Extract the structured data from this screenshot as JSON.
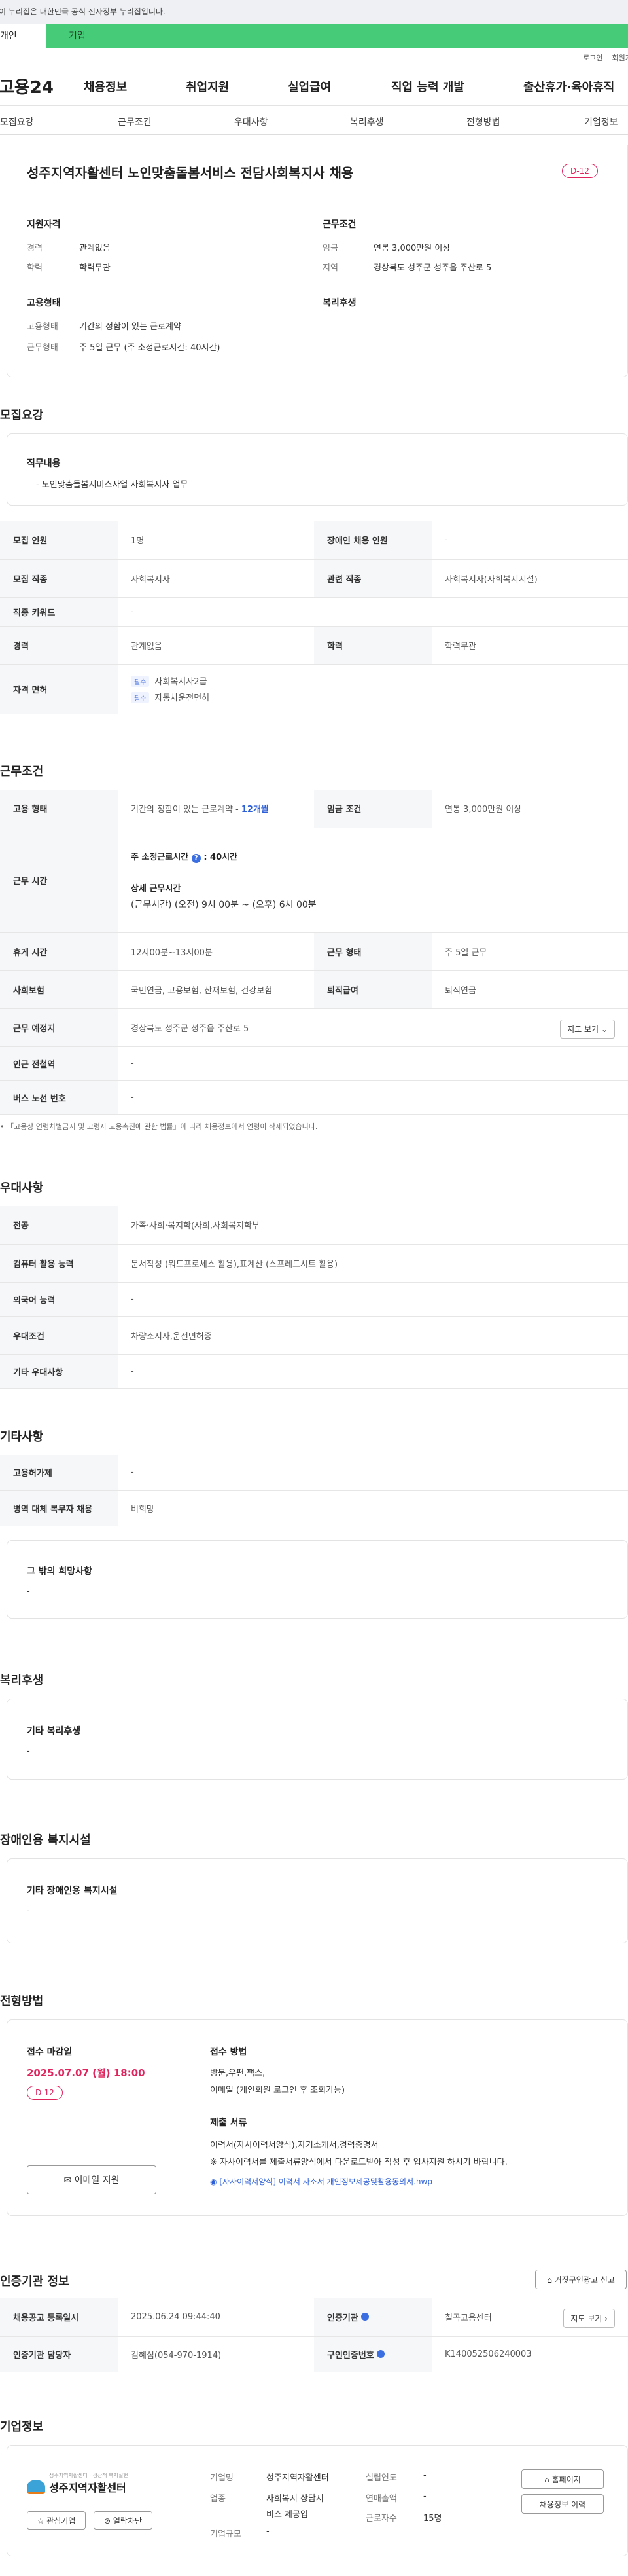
{
  "gov_notice": "이 누리집은 대한민국 공식 전자정부 누리집입니다.",
  "user_tabs": [
    "개인",
    "기업"
  ],
  "util": {
    "login": "로그인",
    "signup": "회원가입"
  },
  "logo": "고용24",
  "gnb": [
    "채용정보",
    "취업지원",
    "실업급여",
    "직업 능력 개발",
    "출산휴가·육아휴직"
  ],
  "snb": [
    "모집요강",
    "근무조건",
    "우대사항",
    "복리후생",
    "전형방법",
    "기업정보"
  ],
  "job": {
    "title": "성주지역자활센터 노인맞춤돌봄서비스 전담사회복지사 채용",
    "dday": "D-12",
    "qual_head": "지원자격",
    "qual_career_label": "경력",
    "qual_career": "관계없음",
    "qual_edu_label": "학력",
    "qual_edu": "학력무관",
    "emp_head": "고용형태",
    "emp_type_label": "고용형태",
    "emp_type": "기간의 정함이 있는 근로계약",
    "emp_form_label": "근무형태",
    "emp_form": "주 5일 근무 (주 소정근로시간: 40시간)",
    "cond_head": "근무조건",
    "cond_wage_label": "임금",
    "cond_wage": "연봉 3,000만원 이상",
    "cond_area_label": "지역",
    "cond_area": "경상북도 성주군 성주읍 주산로 5",
    "welfare_head": "복리후생"
  },
  "recruit": {
    "title": "모집요강",
    "duty_head": "직무내용",
    "duty": "- 노인맞춤돌봄서비스사업 사회복지사 업무",
    "rows": {
      "count_label": "모집 인원",
      "count": "1명",
      "disabled_label": "장애인 채용 인원",
      "disabled": "-",
      "job_label": "모집 직종",
      "job": "사회복지사",
      "related_label": "관련 직종",
      "related": "사회복지사(사회복지시설)",
      "keyword_label": "직종 키워드",
      "keyword": "-",
      "career_label": "경력",
      "career": "관계없음",
      "edu_label": "학력",
      "edu": "학력무관",
      "license_label": "자격 면허",
      "req_tag": "필수",
      "license1": "사회복지사2급",
      "license2": "자동차운전면허"
    }
  },
  "work": {
    "title": "근무조건",
    "emp_label": "고용 형태",
    "emp": "기간의 정함이 있는 근로계약 - ",
    "emp_months": "12개월",
    "wage_label": "임금 조건",
    "wage": "연봉 3,000만원 이상",
    "time_label": "근무 시간",
    "weekly_label": "주 소정근로시간",
    "weekly": ": 40시간",
    "detail_label": "상세 근무시간",
    "detail1": "(근무시간) (오전) 9시 00분 ~ (오후) 6시 00분",
    "break_label": "휴게 시간",
    "break": "12시00분~13시00분",
    "form_label": "근무 형태",
    "form": "주 5일 근무",
    "ins_label": "사회보험",
    "ins": "국민연금, 고용보험, 산재보험, 건강보험",
    "retire_label": "퇴직급여",
    "retire": "퇴직연금",
    "place_label": "근무 예정지",
    "place": "경상북도 성주군 성주읍 주산로 5",
    "map_btn": "지도 보기",
    "subway_label": "인근 전철역",
    "subway": "-",
    "bus_label": "버스 노선 번호",
    "bus": "-",
    "note": "「고용상 연령차별금지 및 고령자 고용촉진에 관한 법률」에 따라 채용정보에서 연령이 삭제되었습니다."
  },
  "pref": {
    "title": "우대사항",
    "major_label": "전공",
    "major": "가족·사회·복지학(사회,사회복지학부",
    "pc_label": "컴퓨터 활용 능력",
    "pc": "문서작성 (워드프로세스 활용),표계산 (스프레드시트 활용)",
    "lang_label": "외국어 능력",
    "lang": "-",
    "cond_label": "우대조건",
    "cond": "차량소지자,운전면허증",
    "etc_label": "기타 우대사항",
    "etc": "-"
  },
  "other": {
    "title": "기타사항",
    "hire_label": "고용허가제",
    "hire": "-",
    "military_label": "병역 대체 복무자 채용",
    "military": "비희망",
    "wish_head": "그 밖의 희망사항",
    "wish": "-"
  },
  "welfare": {
    "title": "복리후생",
    "head": "기타 복리후생",
    "val": "-"
  },
  "facility": {
    "title": "장애인용 복지시설",
    "head": "기타 장애인용 복지시설",
    "val": "-"
  },
  "screen": {
    "title": "전형방법",
    "deadline_head": "접수 마감일",
    "deadline": "2025.07.07 (월) 18:00",
    "dday": "D-12",
    "email_btn": "이메일 지원",
    "method_head": "접수 방법",
    "method1": "방문,우편,팩스,",
    "method2": "이메일 (개인회원 로그인 후 조회가능)",
    "docs_head": "제출 서류",
    "docs1": "이력서(자사이력서양식),자기소개서,경력증명서",
    "docs2": "※ 자사이력서를 제출서류양식에서 다운로드받아 작성 후 입사지원 하시기 바랍니다.",
    "file": "[자사이력서양식] 이력서 자소서 개인정보제공및활용동의서.hwp"
  },
  "cert": {
    "title": "인증기관 정보",
    "report_btn": "거짓구인광고 신고",
    "reg_label": "채용공고 등록일시",
    "reg": "2025.06.24 09:44:40",
    "agency_label": "인증기관",
    "agency": "칠곡고용센터",
    "map_btn": "지도 보기",
    "manager_label": "인증기관 담당자",
    "manager": "김혜심(054-970-1914)",
    "no_label": "구인인증번호",
    "no": "K140052506240003"
  },
  "company": {
    "title": "기업정보",
    "logo_small": "성주지역자활센터 · 생산적 복지실현",
    "logo_name": "성주지역자활센터",
    "fav_btn": "관심기업",
    "block_btn": "열람차단",
    "name_label": "기업명",
    "name": "성주지역자활센터",
    "biz_label": "업종",
    "biz1": "사회복지 상담서",
    "biz2": "비스 제공업",
    "size_label": "기업규모",
    "size": "-",
    "year_label": "설립연도",
    "year": "-",
    "sales_label": "연매출액",
    "sales": "-",
    "emp_label": "근로자수",
    "emp": "15명",
    "home_btn": "홈페이지",
    "history_btn": "채용정보 이력"
  }
}
